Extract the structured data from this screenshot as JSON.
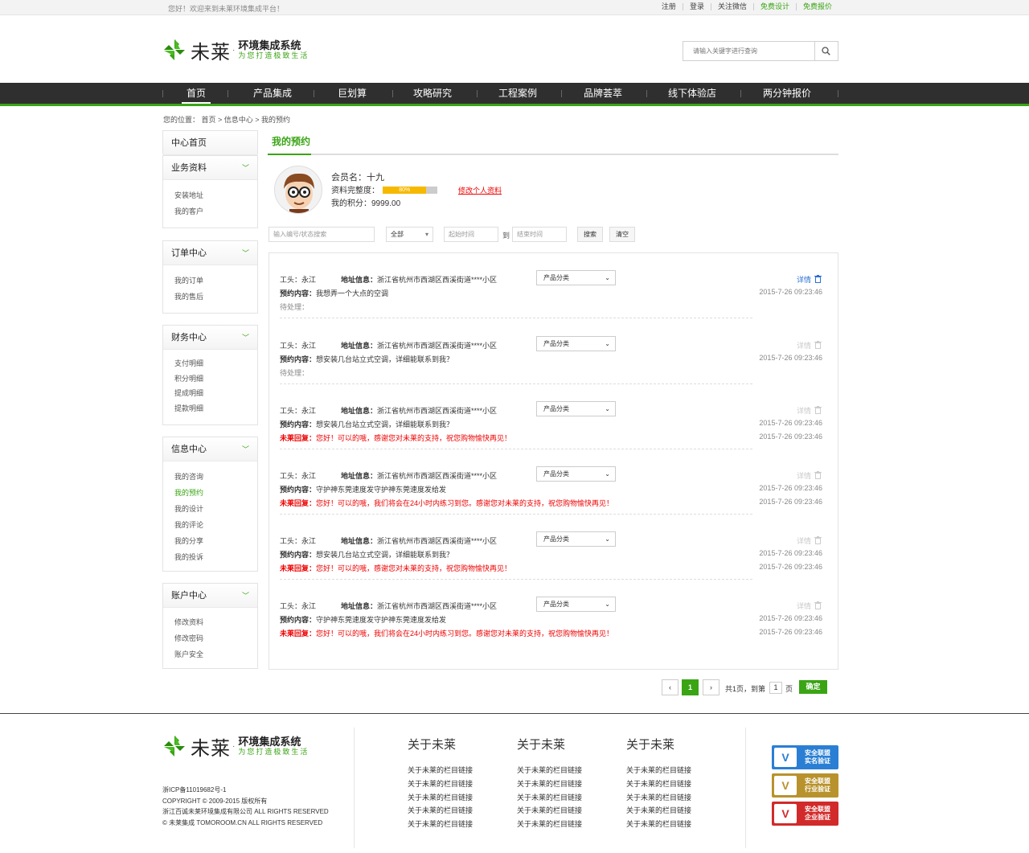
{
  "topbar": {
    "welcome": "您好！欢迎来到未莱环境集成平台！",
    "links": [
      "注册",
      "登录",
      "关注微信",
      "免费设计",
      "免费报价"
    ]
  },
  "logo": {
    "brand": "未莱",
    "dot": "·",
    "title": "环境集成系统",
    "slogan": "为您打造极致生活"
  },
  "search": {
    "placeholder": "请输入关键字进行查询"
  },
  "nav": {
    "items": [
      "首页",
      "产品集成",
      "巨划算",
      "攻略研究",
      "工程案例",
      "品牌荟萃",
      "线下体验店",
      "两分钟报价"
    ]
  },
  "breadcrumb": {
    "label": "您的位置：",
    "path": "首页 > 信息中心 > 我的预约"
  },
  "sidebar": {
    "home": "中心首页",
    "groups": [
      {
        "title": "业务资料",
        "items": [
          "安装地址",
          "我的客户"
        ]
      },
      {
        "title": "订单中心",
        "items": [
          "我的订单",
          "我的售后"
        ]
      },
      {
        "title": "财务中心",
        "items": [
          "支付明细",
          "积分明细",
          "提成明细",
          "提款明细"
        ]
      },
      {
        "title": "信息中心",
        "items": [
          "我的咨询",
          "我的预约",
          "我的设计",
          "我的评论",
          "我的分享",
          "我的投诉"
        ]
      },
      {
        "title": "账户中心",
        "items": [
          "修改资料",
          "修改密码",
          "账户安全"
        ]
      }
    ]
  },
  "main": {
    "title": "我的预约"
  },
  "profile": {
    "member_label": "会员名：十九",
    "completeness_label": "资料完整度：",
    "completeness_pct": 80,
    "completeness_text": "80%",
    "points_label": "我的积分：9999.00",
    "edit_link": "修改个人资料"
  },
  "filters": {
    "keyword_placeholder": "输入编号/状态搜索",
    "status": "全部",
    "start": "起始时间",
    "to": "到",
    "end": "结束时间",
    "search_btn": "搜索",
    "clear_btn": "清空"
  },
  "appointments": [
    {
      "worker": "工头：永江",
      "addr_label": "地址信息：",
      "addr": "浙江省杭州市西湖区西溪街道****小区",
      "content_label": "预约内容：",
      "content": "我想弄一个大点的空调",
      "status": "待处理：",
      "reply": "",
      "category": "产品分类",
      "detail": "详情",
      "time1": "2015-7-26 09:23:46",
      "time2": ""
    },
    {
      "worker": "工头：永江",
      "addr_label": "地址信息：",
      "addr": "浙江省杭州市西湖区西溪街道****小区",
      "content_label": "预约内容：",
      "content": "想安装几台站立式空调，详细能联系到我？",
      "status": "待处理：",
      "reply": "",
      "category": "产品分类",
      "detail": "详情",
      "time1": "2015-7-26 09:23:46",
      "time2": ""
    },
    {
      "worker": "工头：永江",
      "addr_label": "地址信息：",
      "addr": "浙江省杭州市西湖区西溪街道****小区",
      "content_label": "预约内容：",
      "content": "想安装几台站立式空调，详细能联系到我？",
      "status": "",
      "reply_label": "未莱回复：",
      "reply": "您好！可以的哦，感谢您对未莱的支持，祝您购物愉快再见！",
      "category": "产品分类",
      "detail": "详情",
      "time1": "2015-7-26 09:23:46",
      "time2": "2015-7-26 09:23:46"
    },
    {
      "worker": "工头：永江",
      "addr_label": "地址信息：",
      "addr": "浙江省杭州市西湖区西溪街道****小区",
      "content_label": "预约内容：",
      "content": "守护神东莞速度发守护神东莞速度发给发",
      "status": "",
      "reply_label": "未莱回复：",
      "reply": "您好！可以的哦，我们将会在24小时内练习到您。感谢您对未莱的支持，祝您购物愉快再见！",
      "category": "产品分类",
      "detail": "详情",
      "time1": "2015-7-26 09:23:46",
      "time2": "2015-7-26 09:23:46"
    },
    {
      "worker": "工头：永江",
      "addr_label": "地址信息：",
      "addr": "浙江省杭州市西湖区西溪街道****小区",
      "content_label": "预约内容：",
      "content": "想安装几台站立式空调，详细能联系到我？",
      "status": "",
      "reply_label": "未莱回复：",
      "reply": "您好！可以的哦，感谢您对未莱的支持，祝您购物愉快再见！",
      "category": "产品分类",
      "detail": "详情",
      "time1": "2015-7-26 09:23:46",
      "time2": "2015-7-26 09:23:46"
    },
    {
      "worker": "工头：永江",
      "addr_label": "地址信息：",
      "addr": "浙江省杭州市西湖区西溪街道****小区",
      "content_label": "预约内容：",
      "content": "守护神东莞速度发守护神东莞速度发给发",
      "status": "",
      "reply_label": "未莱回复：",
      "reply": "您好！可以的哦，我们将会在24小时内练习到您。感谢您对未莱的支持，祝您购物愉快再见！",
      "category": "产品分类",
      "detail": "详情",
      "time1": "2015-7-26 09:23:46",
      "time2": "2015-7-26 09:23:46"
    }
  ],
  "pagination": {
    "current": "1",
    "total_text": "共1页，到第",
    "page_input": "1",
    "page_suffix": "页",
    "confirm": "确定",
    "prev": "‹",
    "next": "›"
  },
  "footer": {
    "copyright": [
      "浙ICP备11019682号-1",
      "COPYRIGHT © 2009-2015 版权所有",
      "浙江百诚未莱环境集成有限公司  ALL RIGHTS RESERVED",
      "© 未莱集成 TOMOROOM.CN ALL RIGHTS RESERVED"
    ],
    "columns": [
      {
        "title": "关于未莱",
        "links": [
          "关于未莱的栏目链接",
          "关于未莱的栏目链接",
          "关于未莱的栏目链接",
          "关于未莱的栏目链接",
          "关于未莱的栏目链接"
        ]
      },
      {
        "title": "关于未莱",
        "links": [
          "关于未莱的栏目链接",
          "关于未莱的栏目链接",
          "关于未莱的栏目链接",
          "关于未莱的栏目链接",
          "关于未莱的栏目链接"
        ]
      },
      {
        "title": "关于未莱",
        "links": [
          "关于未莱的栏目链接",
          "关于未莱的栏目链接",
          "关于未莱的栏目链接",
          "关于未莱的栏目链接",
          "关于未莱的栏目链接"
        ]
      }
    ],
    "badges": [
      {
        "line1": "安全联盟",
        "line2": "实名验证",
        "color": "#2a7fd4",
        "mark": "V"
      },
      {
        "line1": "安全联盟",
        "line2": "行业验证",
        "color": "#b8922c",
        "mark": "V"
      },
      {
        "line1": "安全联盟",
        "line2": "企业验证",
        "color": "#d22a2a",
        "mark": "V"
      }
    ]
  },
  "colors": {
    "accent": "#3aa415",
    "nav_bg": "#2f2f2f",
    "alert": "#e00000",
    "link_blue": "#2a6fd6"
  }
}
